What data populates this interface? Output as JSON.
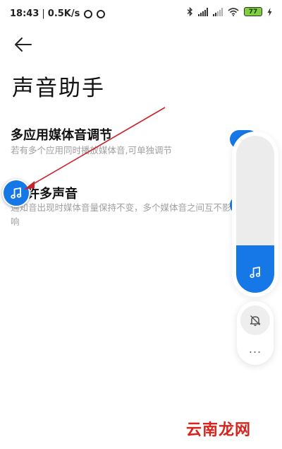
{
  "status_bar": {
    "time": "18:43",
    "separator": "|",
    "network_speed": "0.5K/s",
    "battery_level": "77",
    "icons": [
      "app-icon",
      "bluetooth-icon",
      "signal-icon",
      "signal-icon",
      "wifi-icon",
      "battery-icon",
      "charging-icon"
    ]
  },
  "header": {
    "back_icon": "back-arrow-icon",
    "title": "声音助手"
  },
  "settings": [
    {
      "title": "多应用媒体音调节",
      "description": "若有多个应用同时播放媒体音,可单独调节"
    },
    {
      "title": "许多声音",
      "description": "通知音出现时媒体音量保持不变，多个媒体音之间互不影响"
    }
  ],
  "volume_panel": {
    "level": 0.3,
    "icon": "music-note-icon"
  },
  "ringer_panel": {
    "icon": "bell-muted-icon",
    "more_label": "..."
  },
  "floating_button": {
    "icon": "music-note-icon"
  },
  "watermark": "云南龙网",
  "colors": {
    "accent": "#1677e6",
    "annotation": "#c8232b",
    "watermark": "#d8241d",
    "battery": "#7fce3c"
  }
}
